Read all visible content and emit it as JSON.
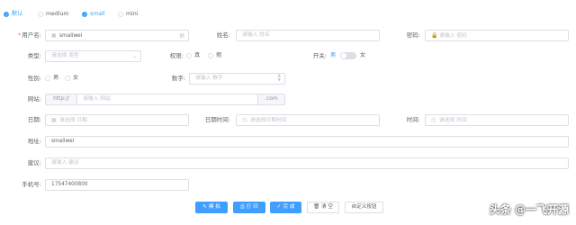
{
  "size_radios": [
    {
      "label": "默认",
      "checked": true
    },
    {
      "label": "medium",
      "checked": false
    },
    {
      "label": "small",
      "checked": true
    },
    {
      "label": "mini",
      "checked": false
    }
  ],
  "form": {
    "username": {
      "label": "用户名:",
      "required_mark": "*",
      "value": "smallwei"
    },
    "name": {
      "label": "姓名:",
      "placeholder": "请输入 姓名"
    },
    "password": {
      "label": "密码:",
      "placeholder": "请输入 密码"
    },
    "type": {
      "label": "类型:",
      "placeholder": "请选择 类型"
    },
    "permission": {
      "label": "权限:",
      "options": [
        "真",
        "假"
      ]
    },
    "switch": {
      "label": "开关:",
      "on_label": "男",
      "off_label": "女"
    },
    "gender": {
      "label": "性别:",
      "options": [
        "男",
        "女"
      ]
    },
    "number": {
      "label": "数字:",
      "placeholder": "请输入 数字"
    },
    "website": {
      "label": "网站:",
      "prefix": "http://",
      "placeholder": "请输入 网站",
      "suffix": ".com"
    },
    "date": {
      "label": "日期:",
      "placeholder": "请选择 日期"
    },
    "datetime": {
      "label": "日期时间:",
      "placeholder": "请选择日期时间"
    },
    "time": {
      "label": "时间:",
      "placeholder": "请选择 时间"
    },
    "address": {
      "label": "地址:",
      "value": "smallwei"
    },
    "suggestion": {
      "label": "建议:",
      "placeholder": "请输入 建议"
    },
    "phone": {
      "label": "手机号:",
      "value": "17547400800"
    }
  },
  "buttons": [
    {
      "label": "模 拟",
      "icon": "edit-icon",
      "glyph": "✎",
      "primary": true
    },
    {
      "label": "打 印",
      "icon": "print-icon",
      "glyph": "⎙",
      "primary": true
    },
    {
      "label": "完 成",
      "icon": "check-icon",
      "glyph": "✓",
      "primary": true
    },
    {
      "label": "清 空",
      "icon": "trash-icon",
      "glyph": "🗑",
      "primary": false
    },
    {
      "label": "自定义按钮",
      "icon": "",
      "glyph": "",
      "primary": false
    }
  ],
  "watermark": "头条 @一飞开源",
  "colors": {
    "primary": "#409eff",
    "border": "#dcdfe6",
    "required": "#f56c6c"
  }
}
